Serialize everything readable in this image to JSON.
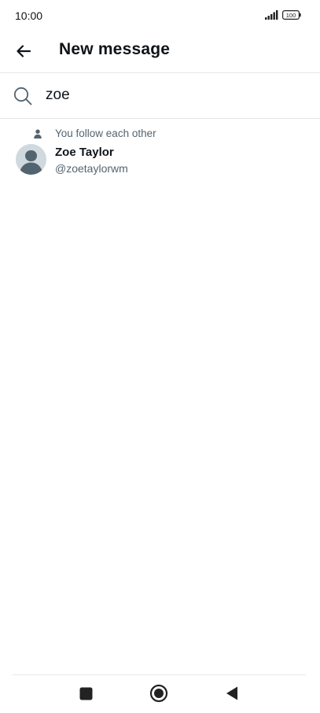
{
  "status_bar": {
    "time": "10:00",
    "battery": "100"
  },
  "header": {
    "title": "New message"
  },
  "search": {
    "value": "zoe",
    "placeholder": ""
  },
  "results": [
    {
      "follow_status": "You follow each other",
      "name": "Zoe Taylor",
      "handle": "@zoetaylorwm"
    }
  ],
  "icons": {
    "back": "arrow-left-icon",
    "search": "search-icon",
    "follow": "person-icon",
    "avatar": "default-avatar-icon",
    "nav_recents": "square-icon",
    "nav_home": "circle-icon",
    "nav_back": "triangle-back-icon"
  },
  "colors": {
    "text_primary": "#0f1419",
    "text_secondary": "#536471",
    "avatar_bg": "#cfd9de",
    "divider": "#e3e6e8"
  }
}
